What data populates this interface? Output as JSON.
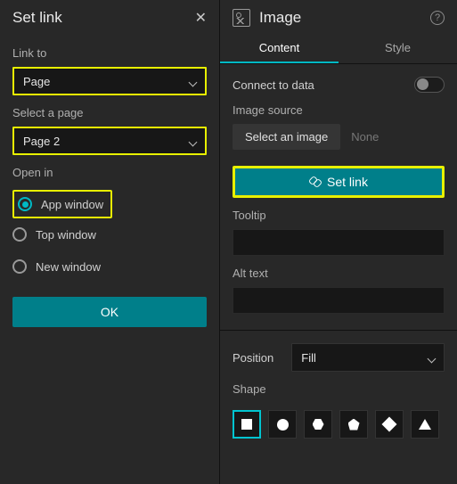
{
  "left": {
    "title": "Set link",
    "link_to_label": "Link to",
    "link_to_value": "Page",
    "select_page_label": "Select a page",
    "select_page_value": "Page 2",
    "open_in_label": "Open in",
    "open_in_options": {
      "app": "App window",
      "top": "Top window",
      "new": "New window"
    },
    "ok": "OK"
  },
  "right": {
    "title": "Image",
    "tabs": {
      "content": "Content",
      "style": "Style"
    },
    "connect": "Connect to data",
    "image_source_label": "Image source",
    "select_image_btn": "Select an image",
    "none": "None",
    "set_link_btn": "Set link",
    "tooltip_label": "Tooltip",
    "alt_label": "Alt text",
    "position_label": "Position",
    "position_value": "Fill",
    "shape_label": "Shape"
  }
}
